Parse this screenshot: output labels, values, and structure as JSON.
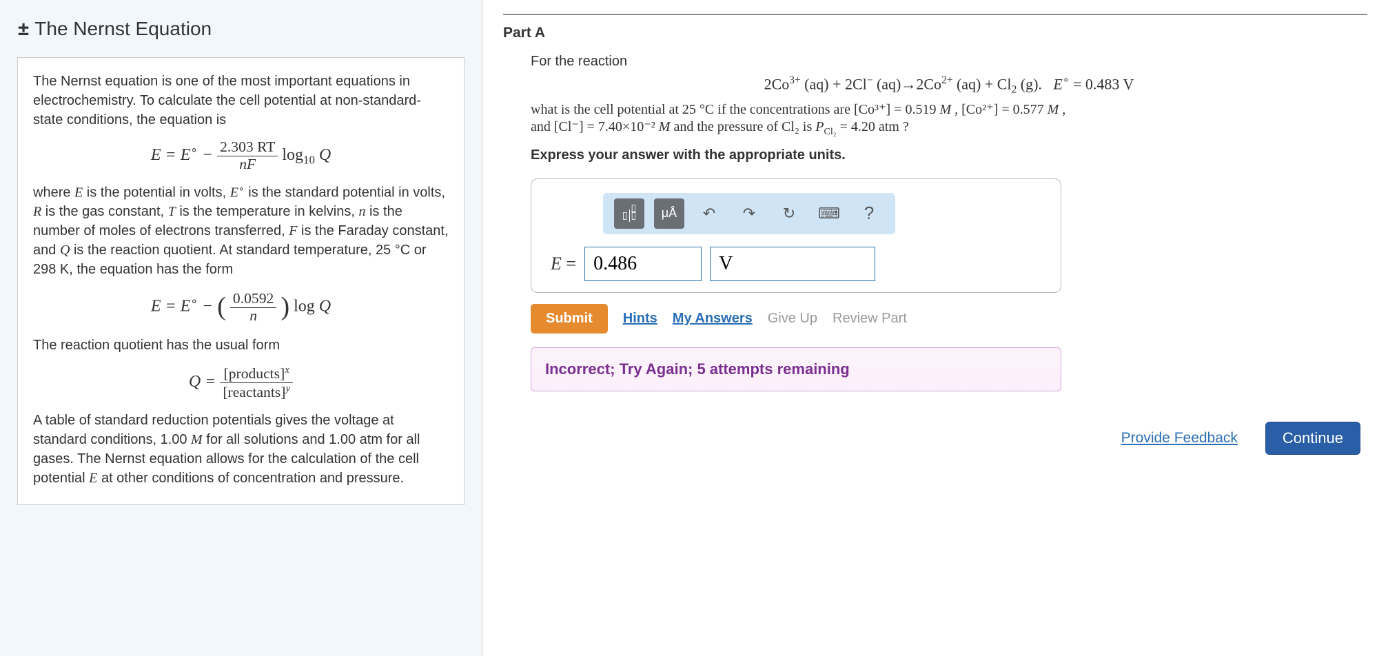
{
  "left": {
    "toggle_glyph": "±",
    "title": "The Nernst Equation",
    "intro": "The Nernst equation is one of the most important equations in electrochemistry. To calculate the cell potential at non-standard-state conditions, the equation is",
    "eq1_E": "E",
    "eq1_eq": " = ",
    "eq1_Eo": "E",
    "eq1_minus": " − ",
    "eq1_num": "2.303 RT",
    "eq1_den": "nF",
    "eq1_log": "log",
    "eq1_logsub": "10",
    "eq1_Q": " Q",
    "where_text_1": "where ",
    "where_text_2": " is the potential in volts, ",
    "where_text_3": " is the standard potential in volts, ",
    "where_text_4": " is the gas constant, ",
    "where_text_5": " is the temperature in kelvins, ",
    "where_text_6": " is the number of moles of electrons transferred, ",
    "where_text_7": " is the Faraday constant, and ",
    "where_text_8": " is the reaction quotient. At standard temperature, 25 °C or 298 K, the equation has the form",
    "sym_E": "E",
    "sym_Eo": "E",
    "sym_R": "R",
    "sym_T": "T",
    "sym_n": "n",
    "sym_F": "F",
    "sym_Q": "Q",
    "eq2_num": "0.0592",
    "eq2_den": "n",
    "eq2_log": "log",
    "eq2_Q": " Q",
    "rq_intro": "The reaction quotient has the usual form",
    "Q_eq": "Q = ",
    "Q_num": "[products]",
    "Q_num_exp": "x",
    "Q_den": "[reactants]",
    "Q_den_exp": "y",
    "closing": "A table of standard reduction potentials gives the voltage at standard conditions, 1.00 ",
    "closing_M": "M",
    "closing_2": " for all solutions and 1.00 atm for all gases. The Nernst equation allows for the calculation of the cell potential ",
    "closing_3": " at other conditions of concentration and pressure."
  },
  "right": {
    "part_label": "Part A",
    "q_intro": "For the reaction",
    "reaction_html": "2Co³⁺ (aq) + 2Cl⁻ (aq)→2Co²⁺ (aq) + Cl₂ (g).   E° = 0.483 V",
    "q_line1_a": "what is the cell potential at 25 °C if the concentrations are [Co³⁺] = 0.519 ",
    "q_line1_M1": "M",
    "q_line1_b": " , [Co²⁺] = 0.577 ",
    "q_line1_M2": "M",
    "q_line1_c": " ,",
    "q_line2_a": "and [Cl⁻] = 7.40×10⁻² ",
    "q_line2_M": "M",
    "q_line2_b": " and the pressure of Cl₂ is ",
    "q_line2_P": "P",
    "q_line2_Psub": "Cl₂",
    "q_line2_c": " = 4.20 atm ?",
    "instruction": "Express your answer with the appropriate units.",
    "toolbar": {
      "templates": "▭▯",
      "units": "μÅ",
      "undo": "↶",
      "redo": "↷",
      "reset": "↻",
      "keyboard": "⌨",
      "help": "?"
    },
    "answer_label": "E = ",
    "answer_value": "0.486",
    "answer_units": "V",
    "buttons": {
      "submit": "Submit",
      "hints": "Hints",
      "my_answers": "My Answers",
      "give_up": "Give Up",
      "review": "Review Part"
    },
    "feedback": "Incorrect; Try Again; 5 attempts remaining",
    "provide_feedback": "Provide Feedback",
    "continue": "Continue"
  }
}
